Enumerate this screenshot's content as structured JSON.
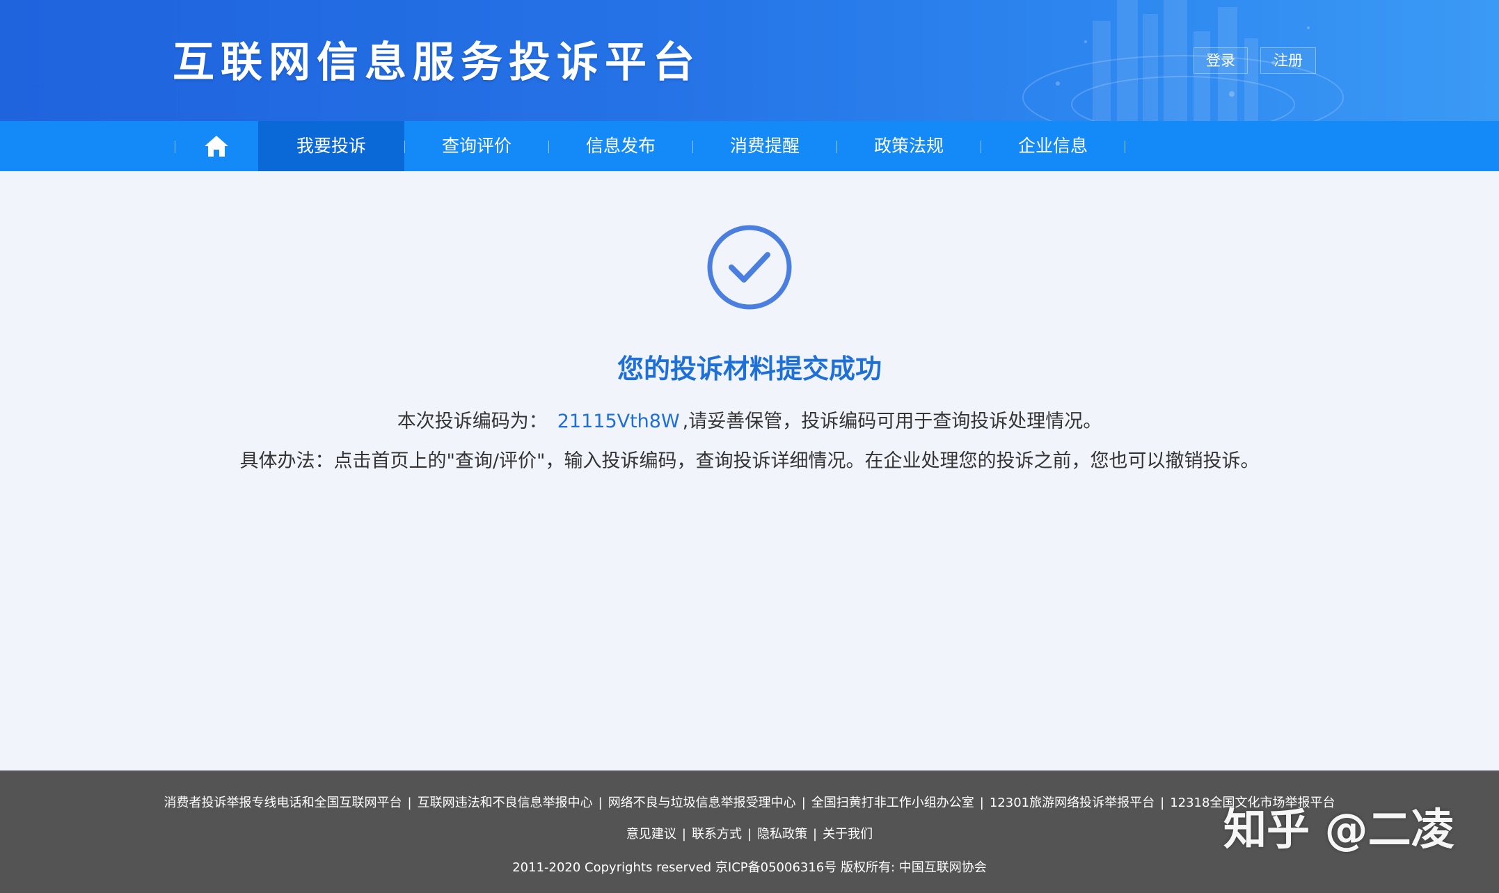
{
  "header": {
    "site_title": "互联网信息服务投诉平台",
    "login_label": "登录",
    "register_label": "注册"
  },
  "nav": {
    "home_icon": "home-icon",
    "items": [
      {
        "label": "我要投诉",
        "active": true
      },
      {
        "label": "查询评价",
        "active": false
      },
      {
        "label": "信息发布",
        "active": false
      },
      {
        "label": "消费提醒",
        "active": false
      },
      {
        "label": "政策法规",
        "active": false
      },
      {
        "label": "企业信息",
        "active": false
      }
    ]
  },
  "main": {
    "status_icon": "check-circle-icon",
    "title": "您的投诉材料提交成功",
    "code_prefix": "本次投诉编码为：",
    "code": "21115Vth8W",
    "code_suffix": ",请妥善保管，投诉编码可用于查询投诉处理情况。",
    "method_text": "具体办法：点击首页上的\"查询/评价\"，输入投诉编码，查询投诉详细情况。在企业处理您的投诉之前，您也可以撤销投诉。"
  },
  "footer": {
    "links": [
      "消费者投诉举报专线电话和全国互联网平台",
      "互联网违法和不良信息举报中心",
      "网络不良与垃圾信息举报受理中心",
      "全国扫黄打非工作小组办公室",
      "12301旅游网络投诉举报平台",
      "12318全国文化市场举报平台"
    ],
    "secondary_links": [
      "意见建议",
      "联系方式",
      "隐私政策",
      "关于我们"
    ],
    "separator": "|",
    "copyright": "2011-2020 Copyrights reserved 京ICP备05006316号 版权所有: 中国互联网协会"
  },
  "watermark": "知乎 @二凌",
  "colors": {
    "header_blue": "#2573e6",
    "nav_blue": "#138af8",
    "nav_active": "#0a69d6",
    "accent": "#1e6fd6",
    "check_icon": "#4a7fe0",
    "footer_bg": "#545454",
    "page_bg": "#f1f5fb"
  }
}
